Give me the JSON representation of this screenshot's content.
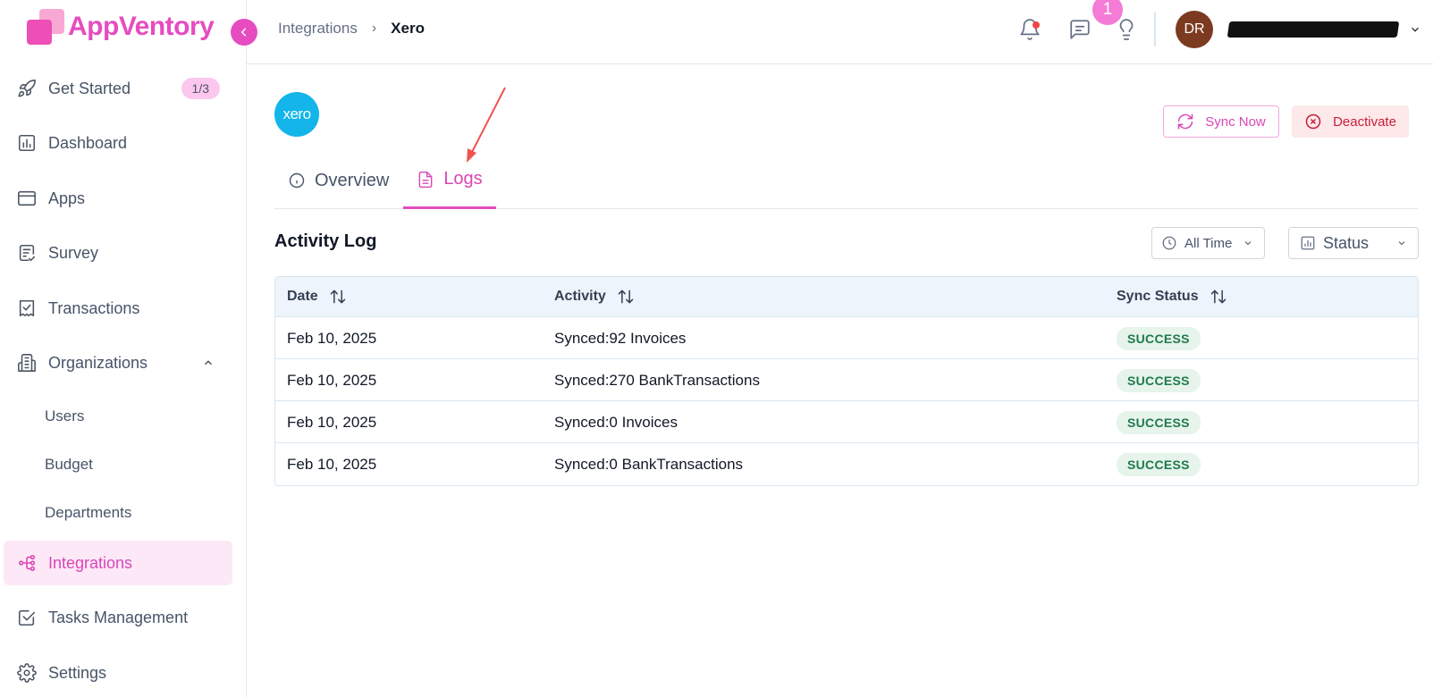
{
  "app": {
    "name": "AppVentory",
    "accent_color": "#e64cc0"
  },
  "sidebar": {
    "items": [
      {
        "label": "Get Started",
        "icon": "rocket-icon",
        "badge": "1/3"
      },
      {
        "label": "Dashboard",
        "icon": "chart-icon"
      },
      {
        "label": "Apps",
        "icon": "window-icon"
      },
      {
        "label": "Survey",
        "icon": "survey-icon"
      },
      {
        "label": "Transactions",
        "icon": "receipt-icon"
      },
      {
        "label": "Organizations",
        "icon": "building-icon",
        "expanded": true
      },
      {
        "label": "Integrations",
        "icon": "integrations-icon",
        "active": true
      },
      {
        "label": "Tasks Management",
        "icon": "checkbox-icon"
      },
      {
        "label": "Settings",
        "icon": "gear-icon"
      }
    ],
    "sub_items": [
      {
        "label": "Users"
      },
      {
        "label": "Budget"
      },
      {
        "label": "Departments"
      }
    ]
  },
  "header": {
    "breadcrumb": {
      "parent": "Integrations",
      "separator": "›",
      "current": "Xero"
    },
    "notification_badge": "1",
    "user_initials": "DR"
  },
  "integration": {
    "logo_text": "xero",
    "logo_color": "#13b5ea",
    "sync_label": "Sync Now",
    "deactivate_label": "Deactivate"
  },
  "tabs": [
    {
      "label": "Overview",
      "icon": "info-icon",
      "active": false
    },
    {
      "label": "Logs",
      "icon": "document-icon",
      "active": true
    }
  ],
  "activity_log": {
    "title": "Activity Log",
    "filter_time": "All Time",
    "filter_status": "Status",
    "columns": [
      "Date",
      "Activity",
      "Sync Status"
    ],
    "rows": [
      {
        "date": "Feb 10, 2025",
        "activity": "Synced:92 Invoices",
        "status": "SUCCESS"
      },
      {
        "date": "Feb 10, 2025",
        "activity": "Synced:270 BankTransactions",
        "status": "SUCCESS"
      },
      {
        "date": "Feb 10, 2025",
        "activity": "Synced:0 Invoices",
        "status": "SUCCESS"
      },
      {
        "date": "Feb 10, 2025",
        "activity": "Synced:0 BankTransactions",
        "status": "SUCCESS"
      }
    ]
  }
}
